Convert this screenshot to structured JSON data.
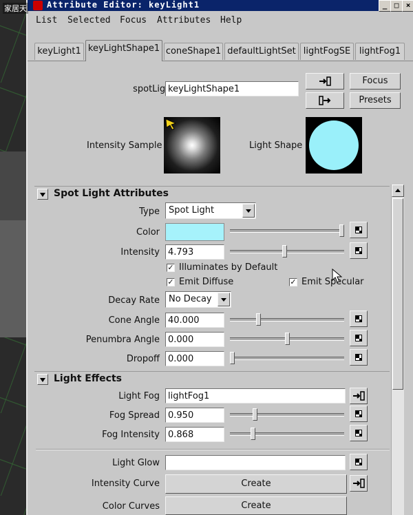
{
  "viewport": {
    "watermark": "家居天"
  },
  "window": {
    "title": "Attribute Editor: keyLight1",
    "controls": [
      "_",
      "□",
      "×"
    ]
  },
  "menu": [
    "List",
    "Selected",
    "Focus",
    "Attributes",
    "Help"
  ],
  "tabs": [
    {
      "label": "keyLight1",
      "active": false
    },
    {
      "label": "keyLightShape1",
      "active": true
    },
    {
      "label": "coneShape1",
      "active": false
    },
    {
      "label": "defaultLightSet",
      "active": false
    },
    {
      "label": "lightFogSE",
      "active": false
    },
    {
      "label": "lightFog1",
      "active": false
    }
  ],
  "node": {
    "type_label": "spotLight:",
    "name_value": "keyLightShape1",
    "focus_label": "Focus",
    "presets_label": "Presets"
  },
  "swatches": {
    "intensity_label": "Intensity Sample",
    "shape_label": "Light Shape",
    "shape_color": "#9af0fa"
  },
  "spot": {
    "section_title": "Spot Light Attributes",
    "type_label": "Type",
    "type_value": "Spot Light",
    "color_label": "Color",
    "color_value": "#a6f2fb",
    "color_slider": 1.0,
    "intensity_label": "Intensity",
    "intensity_value": "4.793",
    "intensity_slider": 0.48,
    "illum_label": "Illuminates by Default",
    "illum_checked": true,
    "diffuse_label": "Emit Diffuse",
    "diffuse_checked": true,
    "specular_label": "Emit Specular",
    "specular_checked": true,
    "decay_label": "Decay Rate",
    "decay_value": "No Decay",
    "cone_label": "Cone Angle",
    "cone_value": "40.000",
    "cone_slider": 0.24,
    "penumbra_label": "Penumbra Angle",
    "penumbra_value": "0.000",
    "penumbra_slider": 0.5,
    "dropoff_label": "Dropoff",
    "dropoff_value": "0.000",
    "dropoff_slider": 0.0
  },
  "effects": {
    "section_title": "Light Effects",
    "fog_label": "Light Fog",
    "fog_value": "lightFog1",
    "spread_label": "Fog Spread",
    "spread_value": "0.950",
    "spread_slider": 0.21,
    "fogint_label": "Fog Intensity",
    "fogint_value": "0.868",
    "fogint_slider": 0.19,
    "glow_label": "Light Glow",
    "glow_value": "",
    "curve_label": "Intensity Curve",
    "curve_button": "Create",
    "colorcurves_label": "Color Curves",
    "colorcurves_button": "Create"
  }
}
